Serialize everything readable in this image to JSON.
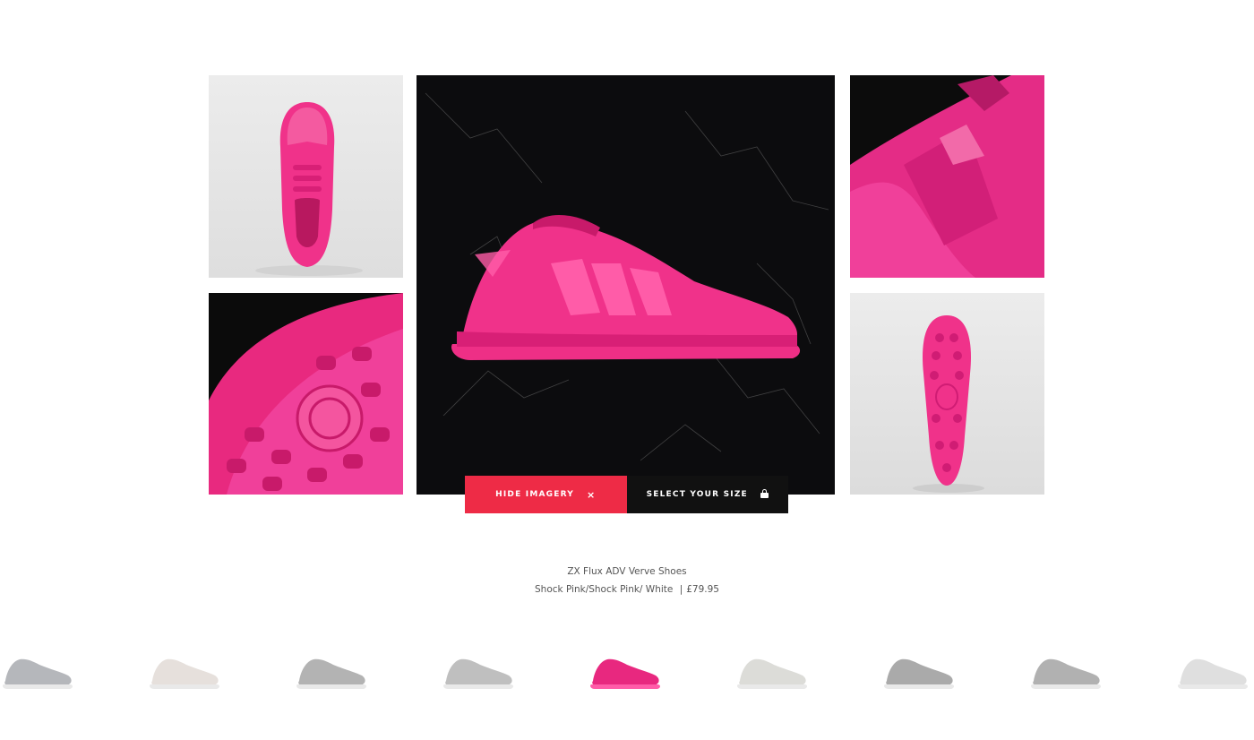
{
  "product": {
    "name": "ZX Flux ADV Verve Shoes",
    "colorway": "Shock Pink/Shock Pink/ White",
    "separator": "|",
    "price": "£79.95"
  },
  "actions": {
    "hide_imagery_label": "HIDE IMAGERY",
    "hide_icon": "×",
    "select_size_label": "SELECT YOUR SIZE"
  },
  "colors": {
    "accent_red": "#ee2b46",
    "dark_button": "#111111",
    "shoe_pink": "#f0328a"
  },
  "gallery": {
    "tiles": [
      "top-view",
      "outsole-close-up",
      "side-view-hero",
      "heel-detail",
      "sole-view"
    ]
  },
  "variants": [
    {
      "color": "#a9abb0",
      "active": false
    },
    {
      "color": "#e2dbd6",
      "active": false
    },
    {
      "color": "#a6a6a6",
      "active": false
    },
    {
      "color": "#b4b4b4",
      "active": false
    },
    {
      "color": "#e8287f",
      "active": true
    },
    {
      "color": "#d6d6d2",
      "active": false
    },
    {
      "color": "#9c9c9c",
      "active": false
    },
    {
      "color": "#a4a4a4",
      "active": false
    },
    {
      "color": "#dadada",
      "active": false
    }
  ]
}
